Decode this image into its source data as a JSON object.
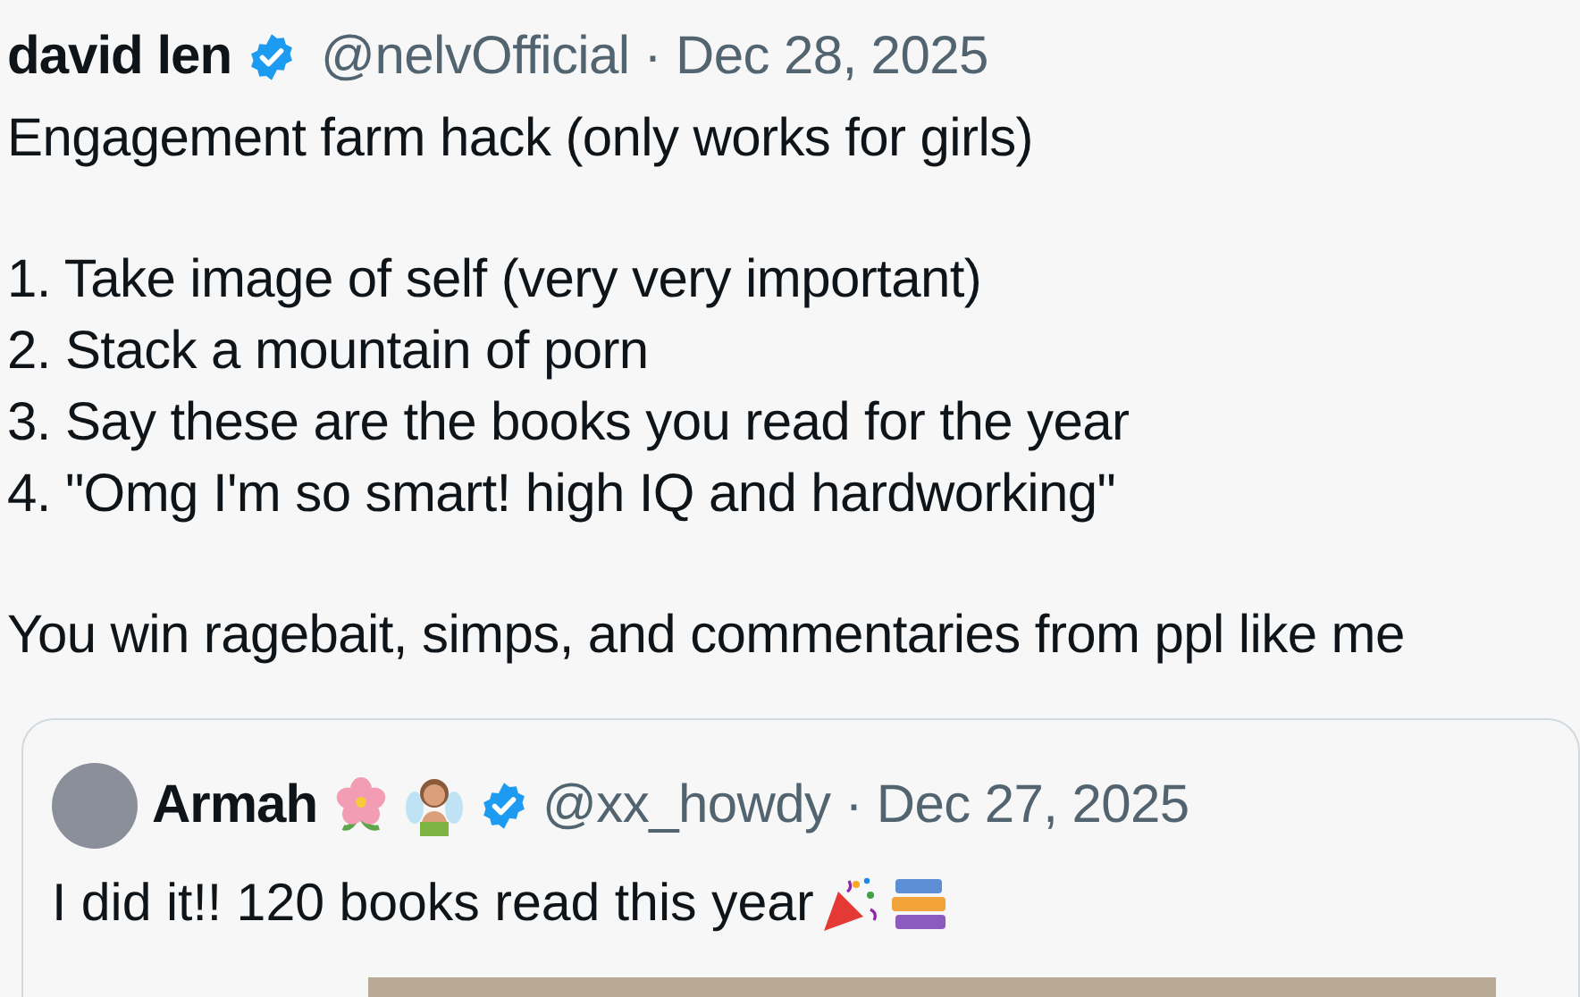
{
  "post": {
    "author": "david len",
    "verified": true,
    "handle": "@nelvOfficial",
    "separator": "·",
    "date": "Dec 28, 2025",
    "paragraphs": [
      "Engagement farm hack (only works for girls)",
      "1. Take image of self (very very important)\n2. Stack a mountain of porn\n3. Say these are the books you read for the year\n4. \"Omg I'm so smart! high IQ and hardworking\"",
      "You win ragebait, simps, and commentaries from ppl like me"
    ]
  },
  "quoted_post": {
    "author": "Armah",
    "verified": true,
    "handle": "@xx_howdy",
    "separator": "·",
    "date": "Dec 27, 2025",
    "text": "I did it!! 120 books read this year"
  }
}
